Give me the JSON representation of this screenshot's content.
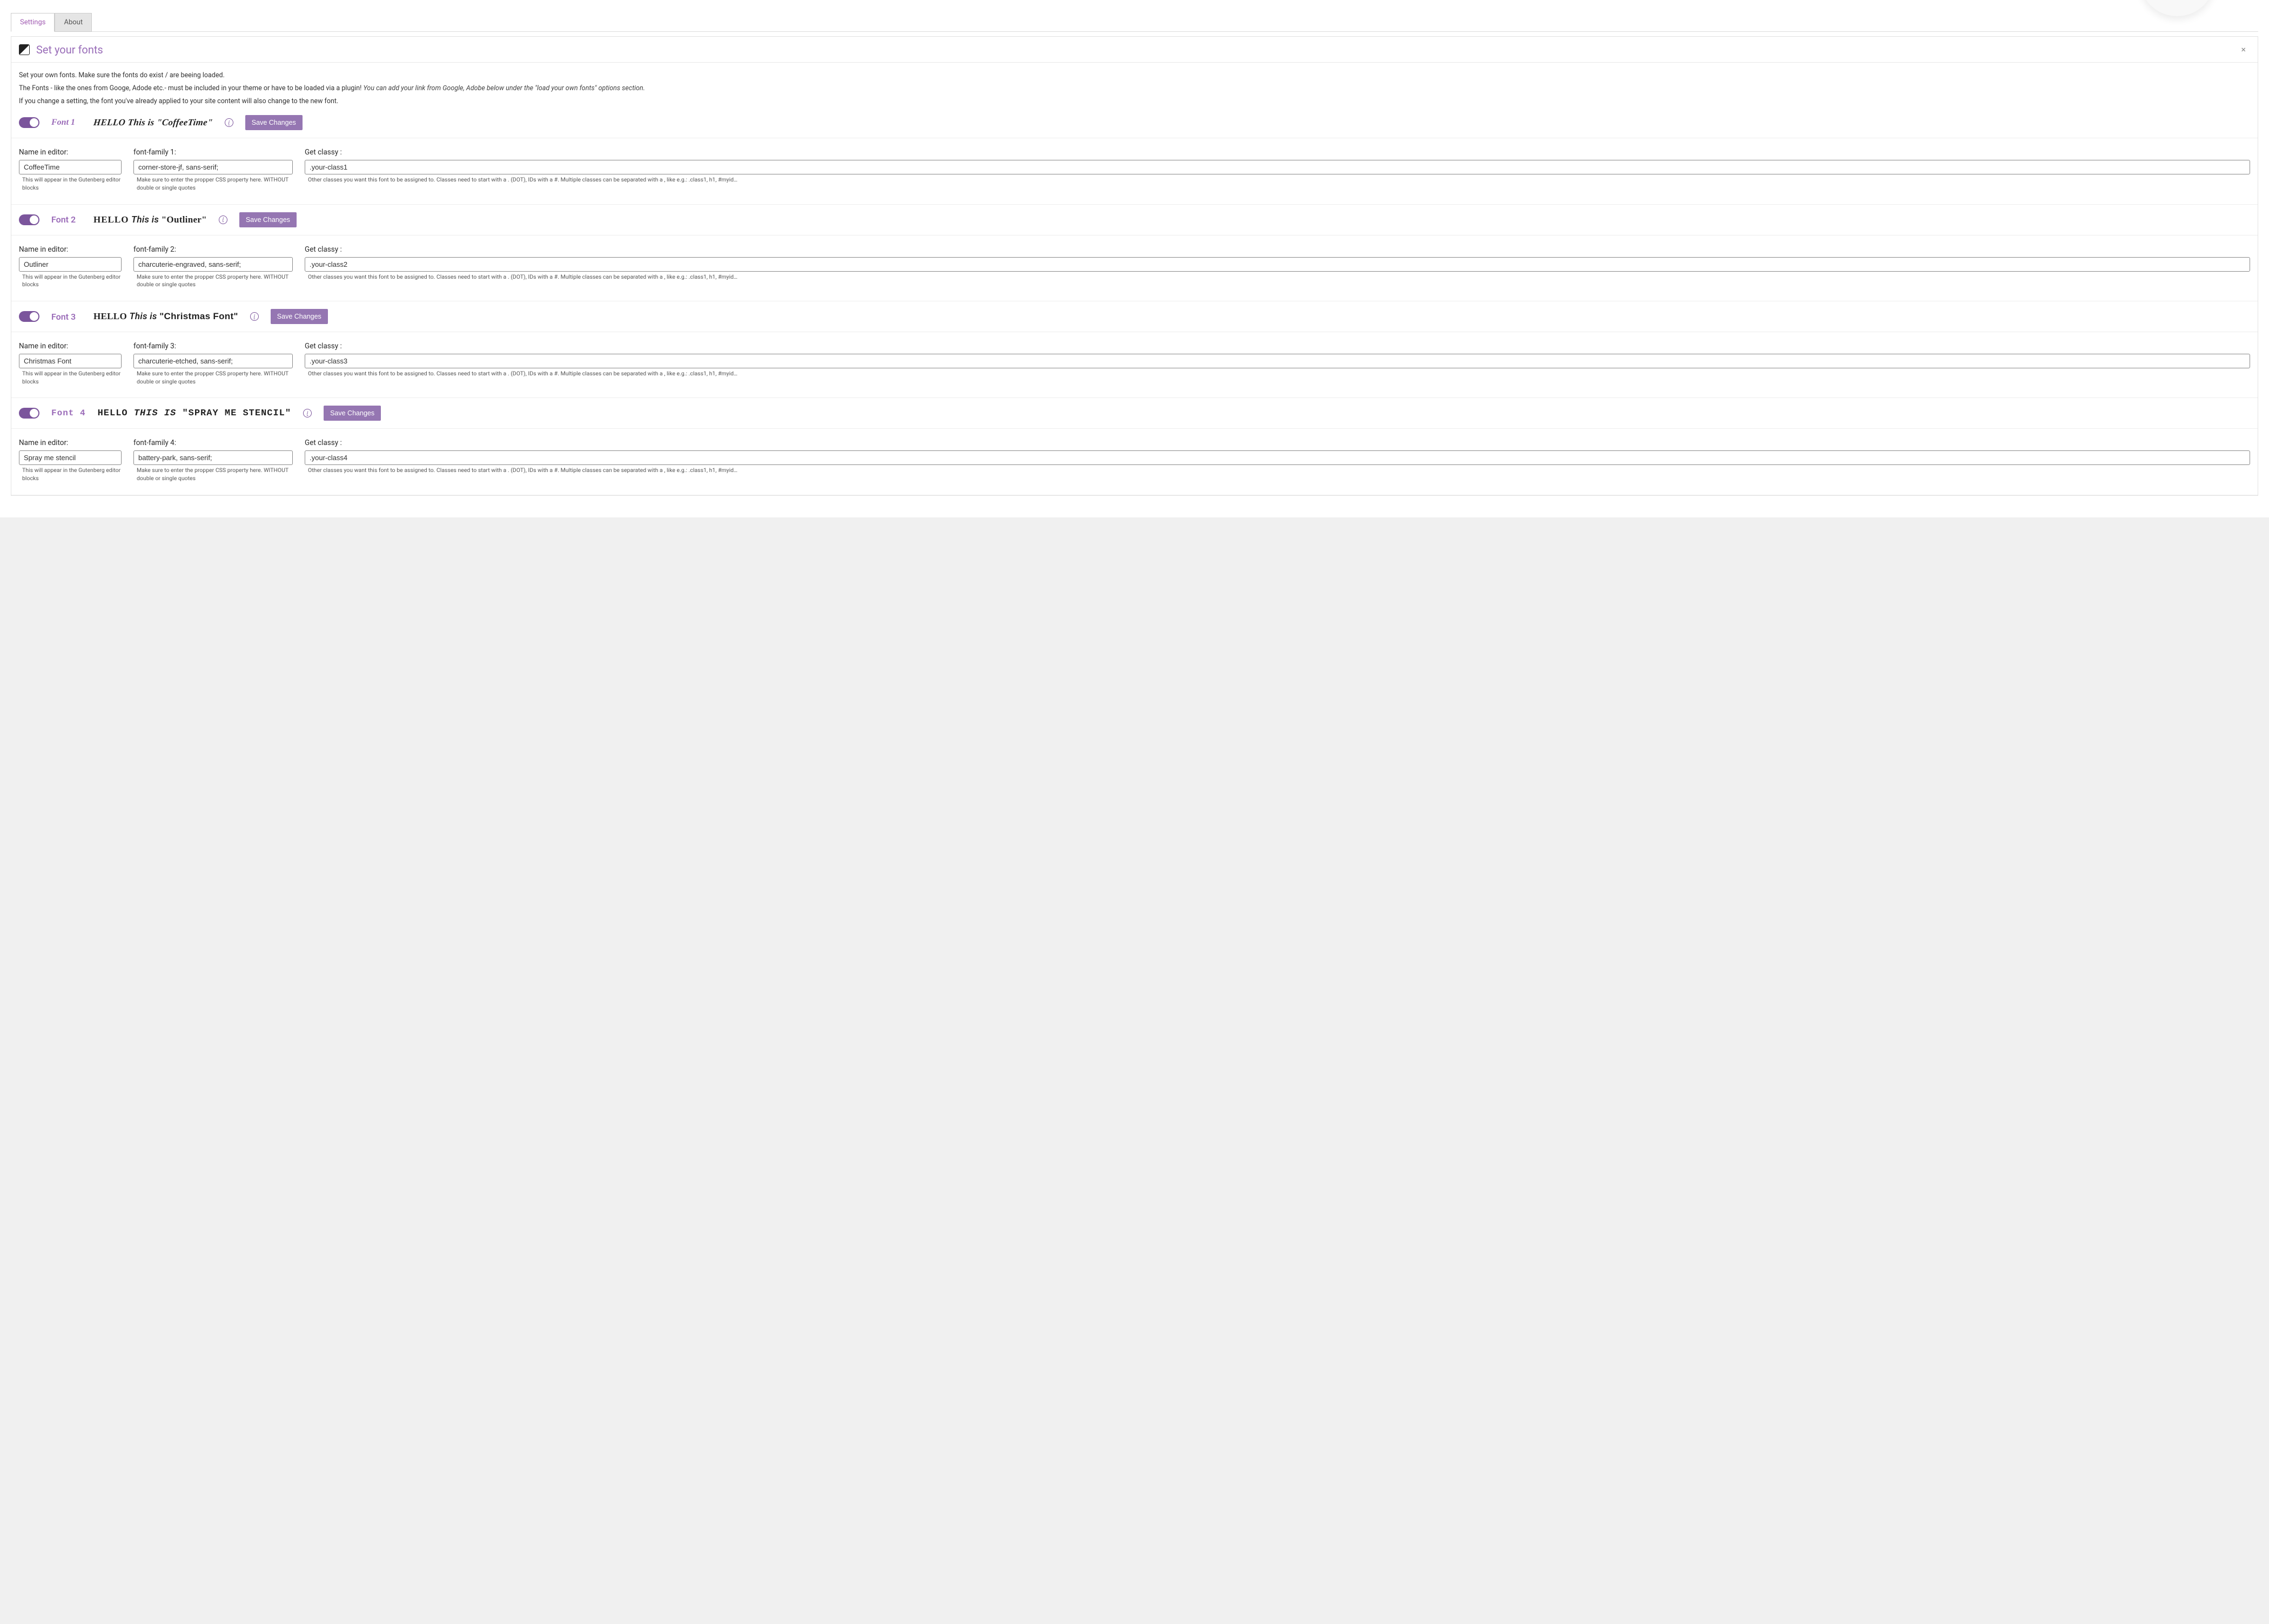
{
  "tabs": {
    "settings": "Settings",
    "about": "About"
  },
  "panel": {
    "title": "Set your fonts",
    "close": "×",
    "intro_line1": "Set your own fonts. Make sure the fonts do exist / are beeing loaded.",
    "intro_line2a": "The Fonts - like the ones from Googe, Adode etc.- must be included in your theme or have to be loaded via a plugin! ",
    "intro_line2b": "You can add your link from Google, Adobe below under the \"load your own fonts\" options section.",
    "intro_line3": "If you change a setting, the font you've already applied to your site content will also change to the new font."
  },
  "common": {
    "name_label": "Name in editor:",
    "name_help": "This will appear in the Gutenberg editor blocks",
    "family_help": "Make sure to enter the propper CSS property here. WITHOUT double or single quotes",
    "classy_label": "Get classy :",
    "classy_help": "Other classes you want this font to be assigned to. Classes need to start with a . (DOT), IDs with a #. Multiple classes can be separated with a , like e.g.: .class1, h1, #myid…",
    "save": "Save Changes",
    "info": "i",
    "hello": "HELLO",
    "thisis": "This is"
  },
  "fonts": [
    {
      "idx": "1",
      "label": "Font 1",
      "preview_name": "\"CoffeeTime\"",
      "family_label": "font-family 1:",
      "name_value": "CoffeeTime",
      "family_value": "corner-store-jf, sans-serif;",
      "classy_value": ".your-class1"
    },
    {
      "idx": "2",
      "label": "Font 2",
      "preview_name": "\"Outliner\"",
      "family_label": "font-family 2:",
      "name_value": "Outliner",
      "family_value": "charcuterie-engraved, sans-serif;",
      "classy_value": ".your-class2"
    },
    {
      "idx": "3",
      "label": "Font 3",
      "preview_name": "\"Christmas Font\"",
      "family_label": "font-family 3:",
      "name_value": "Christmas Font",
      "family_value": "charcuterie-etched, sans-serif;",
      "classy_value": ".your-class3"
    },
    {
      "idx": "4",
      "label": "Font 4",
      "preview_name": "\"Spray me stencil\"",
      "family_label": "font-family 4:",
      "name_value": "Spray me stencil",
      "family_value": "battery-park, sans-serif;",
      "classy_value": ".your-class4"
    }
  ]
}
